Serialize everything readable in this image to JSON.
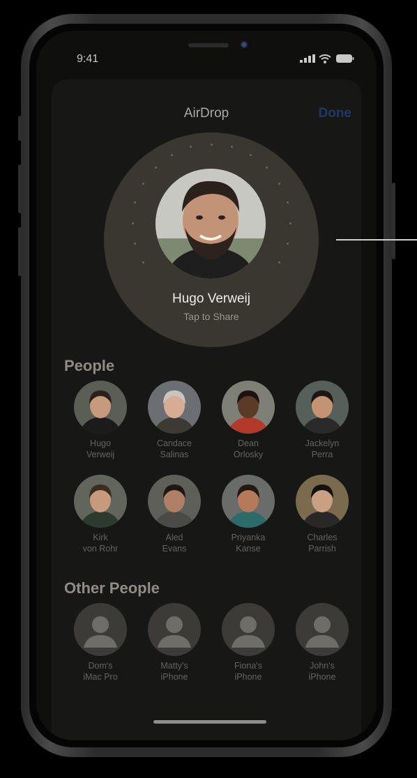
{
  "status_bar": {
    "time": "9:41"
  },
  "header": {
    "title": "AirDrop",
    "done_label": "Done"
  },
  "featured": {
    "name": "Hugo Verweij",
    "subtitle": "Tap to Share"
  },
  "people_section": {
    "title": "People",
    "items": [
      {
        "name": "Hugo\nVerweij",
        "skin": "#c59a7d",
        "hair": "#2a211b",
        "bg": "#5a5e55",
        "shirt": "#1b1b1b"
      },
      {
        "name": "Candace\nSalinas",
        "skin": "#d6ad94",
        "hair": "#c9c6be",
        "bg": "#6b6e72",
        "shirt": "#3d3a36"
      },
      {
        "name": "Dean\nOrlosky",
        "skin": "#5b3a28",
        "hair": "#1a1310",
        "bg": "#7e8078",
        "shirt": "#b23a2b"
      },
      {
        "name": "Jackelyn\nPerra",
        "skin": "#c49373",
        "hair": "#1d1612",
        "bg": "#55605a",
        "shirt": "#2a2a2a"
      },
      {
        "name": "Kirk\nvon Rohr",
        "skin": "#c89a7c",
        "hair": "#3a2c22",
        "bg": "#61655c",
        "shirt": "#2d3a2e"
      },
      {
        "name": "Aled\nEvans",
        "skin": "#b08066",
        "hair": "#1e1814",
        "bg": "#5d5f58",
        "shirt": "#4a4a48"
      },
      {
        "name": "Priyanka\nKanse",
        "skin": "#b47a5a",
        "hair": "#231913",
        "bg": "#6a6c6a",
        "shirt": "#2d6b6a"
      },
      {
        "name": "Charles\nParrish",
        "skin": "#c9a083",
        "hair": "#141210",
        "bg": "#7a6a4e",
        "shirt": "#2a2826"
      }
    ]
  },
  "other_section": {
    "title": "Other People",
    "items": [
      {
        "name": "Dom's\niMac Pro"
      },
      {
        "name": "Matty's\niPhone"
      },
      {
        "name": "Fiona's\niPhone"
      },
      {
        "name": "John's\niPhone"
      }
    ]
  },
  "colors": {
    "done": "#1d3a66",
    "hero_bg": "#3a3731"
  }
}
